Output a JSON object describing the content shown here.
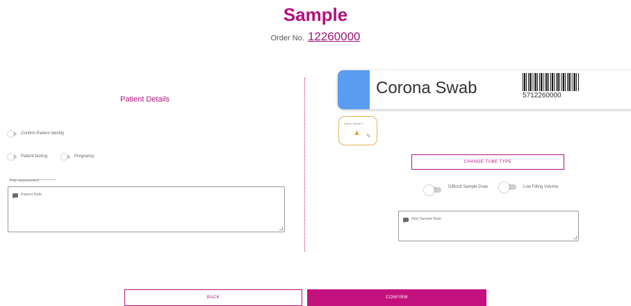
{
  "header": {
    "title": "Sample",
    "order_prefix": "Order No.",
    "order_number": "12260000"
  },
  "patient": {
    "section_title": "Patient Details",
    "confirm_identity_label": "Confirm Patient Identity",
    "fasting_label": "Patient fasting",
    "pregnancy_label": "Pregnancy",
    "pain_placeholder": "Pain assessment",
    "note_placeholder": "Patient Note"
  },
  "sample": {
    "tube_name": "Corona Swab",
    "tube_color": "#5a9cf0",
    "barcode_number": "5712260000",
    "lab_label": "Lab A / Room T...",
    "lab_icon": "flask-icon",
    "change_tube_label": "CHANGE TUBE TYPE",
    "difficult_draw_label": "Difficult Sample Draw",
    "low_volume_label": "Low Filling Volume",
    "note_placeholder": "Add Sample Note"
  },
  "footer": {
    "back_label": "BACK",
    "confirm_label": "CONFIRM"
  },
  "colors": {
    "accent": "#b0127e",
    "confirm_button": "#c3127e",
    "lab_badge_border": "#e3b04f"
  }
}
